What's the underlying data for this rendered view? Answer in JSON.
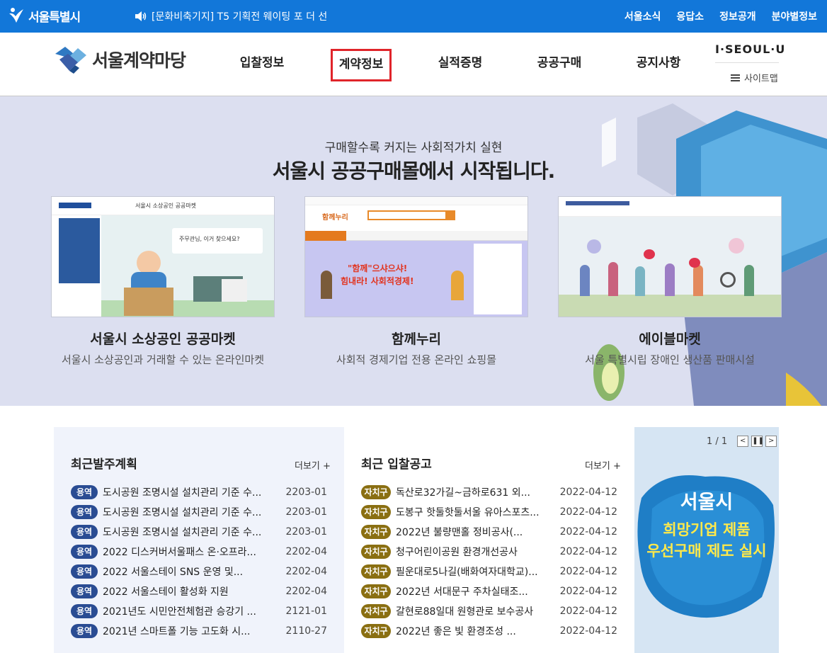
{
  "topbar": {
    "logo_text": "서울특별시",
    "notice": "[문화비축기지] T5 기획전 웨이팅 포 더 선",
    "links": [
      "서울소식",
      "응답소",
      "정보공개",
      "분야별정보"
    ]
  },
  "header": {
    "logo_text": "서울계약마당",
    "nav": [
      "입찰정보",
      "계약정보",
      "실적증명",
      "공공구매",
      "공지사항"
    ],
    "active_nav": "계약정보",
    "brand": "I·SEOUL·U",
    "sitemap": "사이트맵"
  },
  "banner": {
    "subtitle": "구매할수록 커지는 사회적가치 실현",
    "title": "서울시 공공구매몰에서 시작됩니다.",
    "cards": [
      {
        "name": "서울시 소상공인 공공마켓",
        "desc": "서울시 소상공인과 거래할 수 있는 온라인마켓",
        "thumb_header": "서울시 소상공인 공공마켓",
        "thumb_search": "주무관님, 이거 찾으세요?"
      },
      {
        "name": "함께누리",
        "desc": "사회적 경제기업 전용 온라인 쇼핑몰",
        "thumb_logo": "함께누리",
        "thumb_slogan_1": "\"함께\"으샤으샤!",
        "thumb_slogan_2": "힘내라! 사회적경제!"
      },
      {
        "name": "에이블마켓",
        "desc": "서울 특별시립 장애인 생산품 판매시설"
      }
    ]
  },
  "orders": {
    "title": "최근발주계획",
    "more": "더보기 +",
    "items": [
      {
        "badge": "용역",
        "title": "도시공원 조명시설 설치관리 기준 수...",
        "date": "2203-01"
      },
      {
        "badge": "용역",
        "title": "도시공원 조명시설 설치관리 기준 수...",
        "date": "2203-01"
      },
      {
        "badge": "용역",
        "title": "도시공원 조명시설 설치관리 기준 수...",
        "date": "2203-01"
      },
      {
        "badge": "용역",
        "title": "2022 디스커버서울패스 온·오프라...",
        "date": "2202-04"
      },
      {
        "badge": "용역",
        "title": "2022 서울스테이 SNS 운영 및...",
        "date": "2202-04"
      },
      {
        "badge": "용역",
        "title": "2022 서울스테이 활성화 지원",
        "date": "2202-04"
      },
      {
        "badge": "용역",
        "title": "2021년도 시민안전체험관 승강기 ...",
        "date": "2121-01"
      },
      {
        "badge": "용역",
        "title": "2021년 스마트폴 기능 고도화 시...",
        "date": "2110-27"
      }
    ]
  },
  "bids": {
    "title": "최근 입찰공고",
    "more": "더보기 +",
    "items": [
      {
        "badge": "자치구",
        "title": "독산로32가길~금하로631 외...",
        "date": "2022-04-12"
      },
      {
        "badge": "자치구",
        "title": "도봉구 핫둘핫둘서울 유아스포츠...",
        "date": "2022-04-12"
      },
      {
        "badge": "자치구",
        "title": "2022년 불량맨홀 정비공사(...",
        "date": "2022-04-12"
      },
      {
        "badge": "자치구",
        "title": "청구어린이공원 환경개선공사",
        "date": "2022-04-12"
      },
      {
        "badge": "자치구",
        "title": "필운대로5나길(배화여자대학교)...",
        "date": "2022-04-12"
      },
      {
        "badge": "자치구",
        "title": "2022년 서대문구 주차실태조...",
        "date": "2022-04-12"
      },
      {
        "badge": "자치구",
        "title": "갈현로88일대 원형관로 보수공사",
        "date": "2022-04-12"
      },
      {
        "badge": "자치구",
        "title": "2022년 좋은 빛 환경조성 ...",
        "date": "2022-04-12"
      }
    ]
  },
  "promo": {
    "pager": "1 / 1",
    "line1": "서울시",
    "line2": "희망기업 제품",
    "line3": "우선구매 제도 실시"
  }
}
